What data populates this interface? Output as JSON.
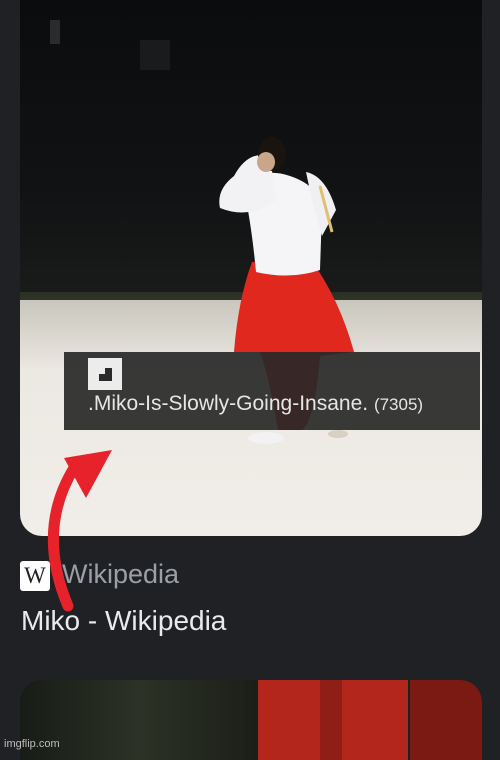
{
  "image_overlay": {
    "filename": ".Miko-Is-Slowly-Going-Insane.",
    "count": "(7305)"
  },
  "result": {
    "source_logo": "W",
    "source_name": "Wikipedia",
    "title": "Miko - Wikipedia"
  },
  "watermark": "imgflip.com",
  "colors": {
    "background": "#202124",
    "arrow": "#e8222a",
    "hakama": "#e0281f"
  }
}
